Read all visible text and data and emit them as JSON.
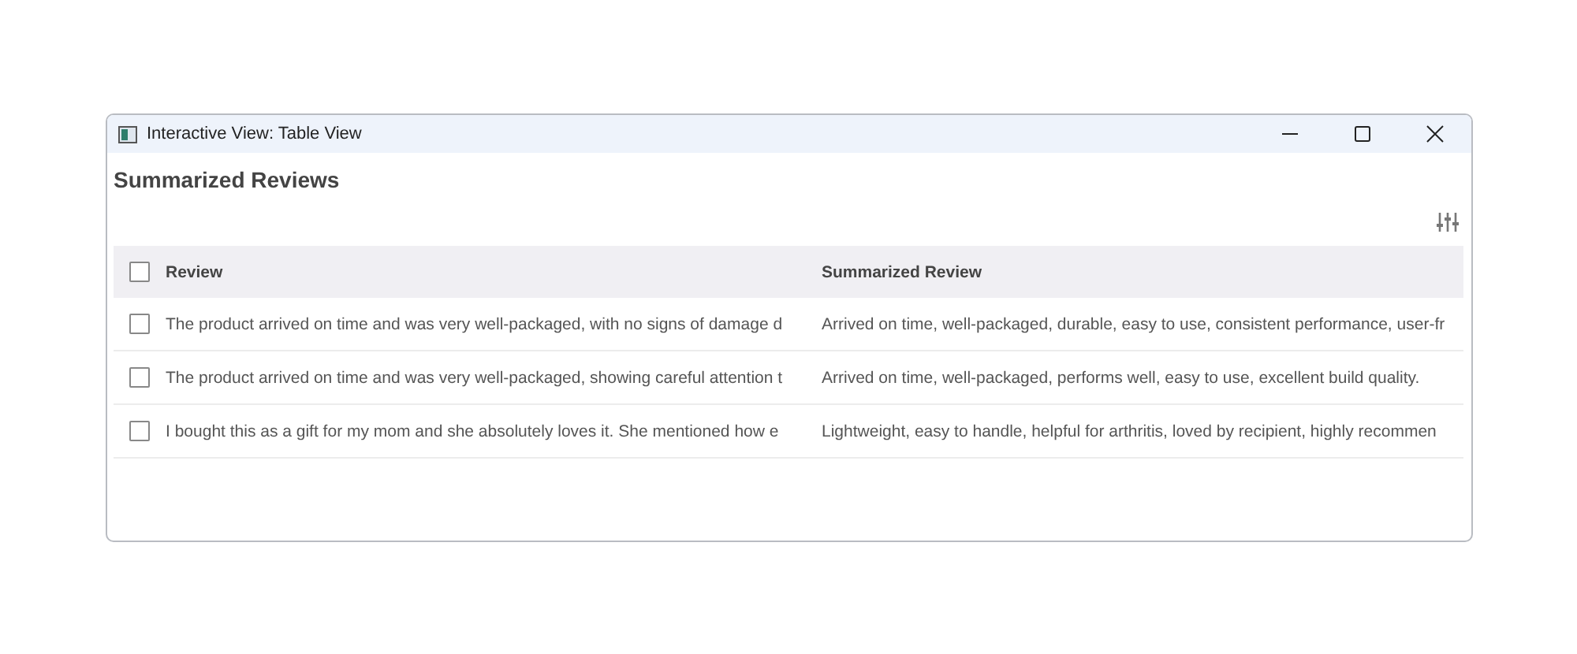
{
  "window": {
    "title": "Interactive View: Table View"
  },
  "heading": "Summarized Reviews",
  "table": {
    "header_checked": false,
    "columns": [
      "Review",
      "Summarized Review"
    ],
    "rows": [
      {
        "checked": false,
        "cells": [
          "The product arrived on time and was very well-packaged, with no signs of damage d",
          "Arrived on time, well-packaged, durable, easy to use, consistent performance, user-fr"
        ]
      },
      {
        "checked": false,
        "cells": [
          "The product arrived on time and was very well-packaged, showing careful attention t",
          "Arrived on time, well-packaged, performs well, easy to use, excellent build quality."
        ]
      },
      {
        "checked": false,
        "cells": [
          "I bought this as a gift for my mom and she absolutely loves it. She mentioned how e",
          "Lightweight, easy to handle, helpful for arthritis, loved by recipient, highly recommen"
        ]
      }
    ]
  }
}
